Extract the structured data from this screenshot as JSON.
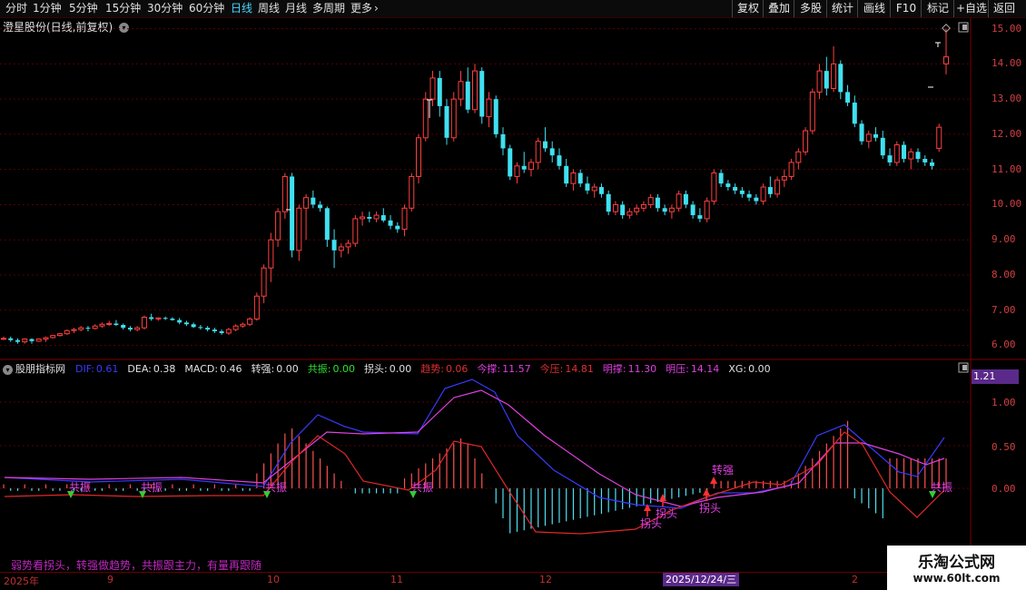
{
  "toolbar": {
    "periods": [
      "分时",
      "1分钟",
      "5分钟",
      "15分钟",
      "30分钟",
      "60分钟",
      "日线",
      "周线",
      "月线",
      "多周期",
      "更多"
    ],
    "active": "日线",
    "right": [
      "复权",
      "叠加",
      "多股",
      "统计",
      "画线",
      "F10",
      "标记",
      "+自选",
      "返回"
    ]
  },
  "chart": {
    "title": "澄星股份(日线,前复权)"
  },
  "price_axis": [
    "15.00",
    "14.00",
    "13.00",
    "12.00",
    "11.00",
    "10.00",
    "9.00",
    "8.00",
    "7.00",
    "6.00"
  ],
  "macd_axis": [
    "1.00",
    "0.50",
    "0.00"
  ],
  "macd_value": "1.21",
  "indicator": {
    "name": "股朋指标网",
    "items": [
      {
        "k": "DIF:",
        "v": "0.61",
        "c": "#3b3bff"
      },
      {
        "k": "DEA:",
        "v": "0.38",
        "c": "#e0e0e0"
      },
      {
        "k": "MACD:",
        "v": "0.46",
        "c": "#e0e0e0"
      },
      {
        "k": "转强:",
        "v": "0.00",
        "c": "#e0e0e0"
      },
      {
        "k": "共振:",
        "v": "0.00",
        "c": "#30e030"
      },
      {
        "k": "拐头:",
        "v": "0.00",
        "c": "#e0e0e0"
      },
      {
        "k": "趋势:",
        "v": "0.06",
        "c": "#e03030"
      },
      {
        "k": "今撑:",
        "v": "11.57",
        "c": "#e040e0"
      },
      {
        "k": "今压:",
        "v": "14.81",
        "c": "#e03030"
      },
      {
        "k": "明撑:",
        "v": "11.30",
        "c": "#e040e0"
      },
      {
        "k": "明压:",
        "v": "14.14",
        "c": "#e040e0"
      },
      {
        "k": "XG:",
        "v": "0.00",
        "c": "#e0e0e0"
      }
    ]
  },
  "signals": {
    "resonance": "共振",
    "strong": "转强",
    "turn": "拐头"
  },
  "footer_text": "弱势看拐头，转强做趋势，共振跟主力，有量再跟随",
  "dates": [
    "2025年",
    "9",
    "10",
    "11",
    "12",
    "2025/12/24/三",
    "2"
  ],
  "watermark": {
    "line1": "乐淘公式网",
    "line2": "www.60lt.com"
  },
  "chart_data": {
    "type": "candlestick",
    "ylim": [
      5.6,
      15.3
    ],
    "candles": [
      [
        6.2,
        6.25,
        6.15,
        6.2
      ],
      [
        6.2,
        6.25,
        6.1,
        6.15
      ],
      [
        6.15,
        6.2,
        6.05,
        6.1
      ],
      [
        6.1,
        6.2,
        6.05,
        6.18
      ],
      [
        6.18,
        6.2,
        6.05,
        6.12
      ],
      [
        6.12,
        6.2,
        6.1,
        6.18
      ],
      [
        6.18,
        6.25,
        6.1,
        6.22
      ],
      [
        6.22,
        6.3,
        6.2,
        6.28
      ],
      [
        6.28,
        6.35,
        6.25,
        6.33
      ],
      [
        6.33,
        6.45,
        6.3,
        6.42
      ],
      [
        6.42,
        6.5,
        6.35,
        6.45
      ],
      [
        6.45,
        6.55,
        6.4,
        6.5
      ],
      [
        6.5,
        6.55,
        6.4,
        6.48
      ],
      [
        6.48,
        6.6,
        6.45,
        6.55
      ],
      [
        6.55,
        6.65,
        6.5,
        6.6
      ],
      [
        6.6,
        6.7,
        6.55,
        6.62
      ],
      [
        6.62,
        6.72,
        6.55,
        6.58
      ],
      [
        6.58,
        6.62,
        6.45,
        6.5
      ],
      [
        6.5,
        6.55,
        6.4,
        6.45
      ],
      [
        6.45,
        6.55,
        6.4,
        6.5
      ],
      [
        6.5,
        6.85,
        6.45,
        6.8
      ],
      [
        6.8,
        6.9,
        6.7,
        6.75
      ],
      [
        6.75,
        6.8,
        6.7,
        6.78
      ],
      [
        6.78,
        6.82,
        6.72,
        6.76
      ],
      [
        6.76,
        6.8,
        6.7,
        6.72
      ],
      [
        6.72,
        6.78,
        6.6,
        6.65
      ],
      [
        6.65,
        6.7,
        6.55,
        6.6
      ],
      [
        6.6,
        6.65,
        6.5,
        6.52
      ],
      [
        6.52,
        6.58,
        6.45,
        6.5
      ],
      [
        6.5,
        6.55,
        6.4,
        6.45
      ],
      [
        6.45,
        6.5,
        6.35,
        6.4
      ],
      [
        6.4,
        6.45,
        6.3,
        6.35
      ],
      [
        6.35,
        6.5,
        6.3,
        6.45
      ],
      [
        6.45,
        6.6,
        6.4,
        6.55
      ],
      [
        6.55,
        6.65,
        6.5,
        6.6
      ],
      [
        6.6,
        6.8,
        6.55,
        6.75
      ],
      [
        6.75,
        7.5,
        6.7,
        7.4
      ],
      [
        7.4,
        8.3,
        7.2,
        8.2
      ],
      [
        8.2,
        9.2,
        7.8,
        9.0
      ],
      [
        9.0,
        9.9,
        8.8,
        9.8
      ],
      [
        9.8,
        10.9,
        9.6,
        10.8
      ],
      [
        10.8,
        10.9,
        8.5,
        8.7
      ],
      [
        8.7,
        10.0,
        8.4,
        9.9
      ],
      [
        9.9,
        10.3,
        9.0,
        10.2
      ],
      [
        10.2,
        10.4,
        9.9,
        10.0
      ],
      [
        10.0,
        10.1,
        9.8,
        9.9
      ],
      [
        9.9,
        9.95,
        8.8,
        9.0
      ],
      [
        9.0,
        9.3,
        8.2,
        8.7
      ],
      [
        8.7,
        8.9,
        8.5,
        8.8
      ],
      [
        8.8,
        9.0,
        8.6,
        8.9
      ],
      [
        8.9,
        9.7,
        8.8,
        9.6
      ],
      [
        9.6,
        9.8,
        9.4,
        9.65
      ],
      [
        9.65,
        9.8,
        9.5,
        9.6
      ],
      [
        9.6,
        9.8,
        9.5,
        9.7
      ],
      [
        9.7,
        9.9,
        9.5,
        9.55
      ],
      [
        9.55,
        9.7,
        9.3,
        9.4
      ],
      [
        9.4,
        9.5,
        9.2,
        9.3
      ],
      [
        9.3,
        10.0,
        9.1,
        9.9
      ],
      [
        9.9,
        10.9,
        9.8,
        10.8
      ],
      [
        10.8,
        12.0,
        10.6,
        11.9
      ],
      [
        11.9,
        13.2,
        11.8,
        13.0
      ],
      [
        13.0,
        13.8,
        12.8,
        13.6
      ],
      [
        13.6,
        13.8,
        12.5,
        12.8
      ],
      [
        12.8,
        13.0,
        11.7,
        11.9
      ],
      [
        11.9,
        13.2,
        11.8,
        13.0
      ],
      [
        13.0,
        13.8,
        12.8,
        13.5
      ],
      [
        13.5,
        13.9,
        12.6,
        12.7
      ],
      [
        12.7,
        14.0,
        12.6,
        13.8
      ],
      [
        13.8,
        13.9,
        12.3,
        12.5
      ],
      [
        12.5,
        13.2,
        12.2,
        13.0
      ],
      [
        13.0,
        13.1,
        11.9,
        12.0
      ],
      [
        12.0,
        12.2,
        11.4,
        11.6
      ],
      [
        11.6,
        11.7,
        10.7,
        10.8
      ],
      [
        10.8,
        11.2,
        10.6,
        11.1
      ],
      [
        11.1,
        11.5,
        10.9,
        11.0
      ],
      [
        11.0,
        11.3,
        10.8,
        11.2
      ],
      [
        11.2,
        11.9,
        11.0,
        11.8
      ],
      [
        11.8,
        12.2,
        11.5,
        11.6
      ],
      [
        11.6,
        11.8,
        11.2,
        11.4
      ],
      [
        11.4,
        11.6,
        11.0,
        11.1
      ],
      [
        11.1,
        11.3,
        10.5,
        10.6
      ],
      [
        10.6,
        11.0,
        10.4,
        10.9
      ],
      [
        10.9,
        11.0,
        10.5,
        10.6
      ],
      [
        10.6,
        10.8,
        10.3,
        10.4
      ],
      [
        10.4,
        10.6,
        10.2,
        10.5
      ],
      [
        10.5,
        10.6,
        10.2,
        10.3
      ],
      [
        10.3,
        10.4,
        9.7,
        9.8
      ],
      [
        9.8,
        10.1,
        9.7,
        10.0
      ],
      [
        10.0,
        10.1,
        9.6,
        9.7
      ],
      [
        9.7,
        9.9,
        9.6,
        9.8
      ],
      [
        9.8,
        10.0,
        9.7,
        9.9
      ],
      [
        9.9,
        10.1,
        9.8,
        10.0
      ],
      [
        10.0,
        10.3,
        9.9,
        10.2
      ],
      [
        10.2,
        10.3,
        9.8,
        9.9
      ],
      [
        9.9,
        10.0,
        9.7,
        9.8
      ],
      [
        9.8,
        10.0,
        9.6,
        9.9
      ],
      [
        9.9,
        10.4,
        9.8,
        10.3
      ],
      [
        10.3,
        10.4,
        9.9,
        10.0
      ],
      [
        10.0,
        10.1,
        9.6,
        9.7
      ],
      [
        9.7,
        9.9,
        9.5,
        9.6
      ],
      [
        9.6,
        10.2,
        9.5,
        10.1
      ],
      [
        10.1,
        11.0,
        10.0,
        10.9
      ],
      [
        10.9,
        11.0,
        10.5,
        10.6
      ],
      [
        10.6,
        10.7,
        10.4,
        10.5
      ],
      [
        10.5,
        10.6,
        10.3,
        10.4
      ],
      [
        10.4,
        10.5,
        10.2,
        10.3
      ],
      [
        10.3,
        10.4,
        10.1,
        10.2
      ],
      [
        10.2,
        10.3,
        10.0,
        10.1
      ],
      [
        10.1,
        10.6,
        10.0,
        10.5
      ],
      [
        10.5,
        10.8,
        10.2,
        10.3
      ],
      [
        10.3,
        10.8,
        10.2,
        10.7
      ],
      [
        10.7,
        11.0,
        10.5,
        10.8
      ],
      [
        10.8,
        11.3,
        10.7,
        11.2
      ],
      [
        11.2,
        11.6,
        11.0,
        11.5
      ],
      [
        11.5,
        12.2,
        11.4,
        12.1
      ],
      [
        12.1,
        13.3,
        12.0,
        13.2
      ],
      [
        13.2,
        14.0,
        13.0,
        13.8
      ],
      [
        13.8,
        14.2,
        13.1,
        13.3
      ],
      [
        13.3,
        14.5,
        13.2,
        14.0
      ],
      [
        14.0,
        14.1,
        13.0,
        13.2
      ],
      [
        13.2,
        13.4,
        12.8,
        12.9
      ],
      [
        12.9,
        13.1,
        12.2,
        12.3
      ],
      [
        12.3,
        12.4,
        11.7,
        11.8
      ],
      [
        11.8,
        12.1,
        11.6,
        12.0
      ],
      [
        12.0,
        12.2,
        11.8,
        11.9
      ],
      [
        11.9,
        12.1,
        11.3,
        11.4
      ],
      [
        11.4,
        11.6,
        11.1,
        11.2
      ],
      [
        11.2,
        11.8,
        11.1,
        11.7
      ],
      [
        11.7,
        11.8,
        11.2,
        11.3
      ],
      [
        11.3,
        11.6,
        11.0,
        11.5
      ],
      [
        11.5,
        11.6,
        11.2,
        11.3
      ],
      [
        11.3,
        11.4,
        11.1,
        11.2
      ],
      [
        11.2,
        11.3,
        11.0,
        11.1
      ],
      [
        11.6,
        12.3,
        11.5,
        12.2
      ],
      [
        14.0,
        15.0,
        13.7,
        14.2
      ]
    ]
  }
}
